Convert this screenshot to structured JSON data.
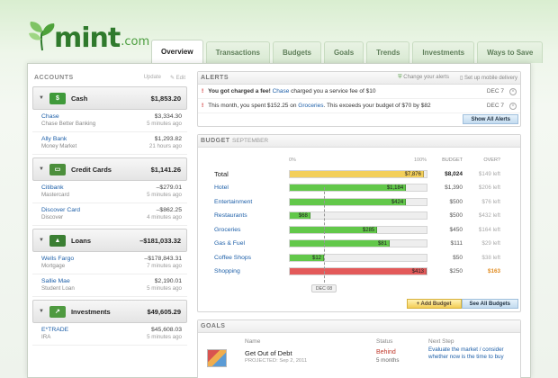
{
  "brand": {
    "name": "mint",
    "suffix": ".com"
  },
  "tabs": [
    {
      "label": "Overview",
      "active": true
    },
    {
      "label": "Transactions"
    },
    {
      "label": "Budgets"
    },
    {
      "label": "Goals"
    },
    {
      "label": "Trends"
    },
    {
      "label": "Investments"
    },
    {
      "label": "Ways to Save"
    }
  ],
  "sidebar": {
    "title": "ACCOUNTS",
    "update": "Update",
    "edit": "Edit",
    "groups": [
      {
        "name": "Cash",
        "total": "$1,853.20",
        "icon": "cash-icon",
        "accounts": [
          {
            "name": "Chase",
            "sub": "Chase Better Banking",
            "amount": "$3,334.30",
            "time": "5 minutes ago"
          },
          {
            "name": "Ally Bank",
            "sub": "Money Market",
            "amount": "$1,293.82",
            "time": "21 hours ago"
          }
        ]
      },
      {
        "name": "Credit Cards",
        "total": "$1,141.26",
        "icon": "credit-card-icon",
        "accounts": [
          {
            "name": "Citibank",
            "sub": "Mastercard",
            "amount": "–$279.01",
            "time": "5 minutes ago"
          },
          {
            "name": "Discover Card",
            "sub": "Discover",
            "amount": "–$862.25",
            "time": "4 minutes ago"
          }
        ]
      },
      {
        "name": "Loans",
        "total": "–$181,033.32",
        "icon": "graduation-cap-icon",
        "accounts": [
          {
            "name": "Wells Fargo",
            "sub": "Mortgage",
            "amount": "–$178,843.31",
            "time": "7 minutes ago"
          },
          {
            "name": "Sallie Mae",
            "sub": "Student Loan",
            "amount": "$2,190.01",
            "time": "5 minutes ago"
          }
        ]
      },
      {
        "name": "Investments",
        "total": "$49,605.29",
        "icon": "chart-icon",
        "accounts": [
          {
            "name": "E*TRADE",
            "sub": "IRA",
            "amount": "$45,608.03",
            "time": "5 minutes ago"
          }
        ]
      }
    ]
  },
  "alerts": {
    "title": "ALERTS",
    "change_link": "Change your alerts",
    "mobile_link": "Set up mobile delivery",
    "show_all": "Show All Alerts",
    "items": [
      {
        "pre": "You got charged a fee! ",
        "link": "Chase",
        "post": " charged you a service fee of $10",
        "date": "DEC 7",
        "bold": true
      },
      {
        "pre": "This month, you spent $152.25 on ",
        "link": "Groceries",
        "post": ". This exceeds your budget of $70 by $82",
        "date": "DEC 7",
        "bold": false
      }
    ]
  },
  "budget": {
    "title": "BUDGET",
    "month": "SEPTEMBER",
    "col_start": "0%",
    "col_end": "100%",
    "col_budget": "BUDGET",
    "col_over": "OVER?",
    "today_marker": "DEC 08",
    "today_fraction": 0.25,
    "add_button": "+ Add Budget",
    "see_all": "See All Budgets",
    "rows": [
      {
        "name": "Total",
        "spent": "$7,876",
        "fraction": 0.98,
        "budget": "$8,024",
        "over": "$149 left",
        "color": "#f3cf5a",
        "total": true
      },
      {
        "name": "Hotel",
        "spent": "$1,184",
        "fraction": 0.85,
        "budget": "$1,390",
        "over": "$206 left",
        "color": "#62c84a"
      },
      {
        "name": "Entertainment",
        "spent": "$424",
        "fraction": 0.85,
        "budget": "$500",
        "over": "$76 left",
        "color": "#62c84a"
      },
      {
        "name": "Restaurants",
        "spent": "$68",
        "fraction": 0.15,
        "budget": "$500",
        "over": "$432 left",
        "color": "#62c84a"
      },
      {
        "name": "Groceries",
        "spent": "$285",
        "fraction": 0.64,
        "budget": "$450",
        "over": "$164 left",
        "color": "#62c84a"
      },
      {
        "name": "Gas & Fuel",
        "spent": "$81",
        "fraction": 0.73,
        "budget": "$111",
        "over": "$29 left",
        "color": "#62c84a"
      },
      {
        "name": "Coffee Shops",
        "spent": "$12",
        "fraction": 0.25,
        "budget": "$50",
        "over": "$38 left",
        "color": "#62c84a"
      },
      {
        "name": "Shopping",
        "spent": "$413",
        "fraction": 1.0,
        "budget": "$250",
        "over": "$163",
        "color": "#e35a5a",
        "overbudget": true
      }
    ]
  },
  "goals": {
    "title": "GOALS",
    "col_name": "Name",
    "col_status": "Status",
    "col_next": "Next Step",
    "items": [
      {
        "name": "Get Out of Debt",
        "projected": "PROJECTED: Sep 2, 2011",
        "status": "Behind",
        "status_sub": "5 months",
        "next": "Evaluate the market / consider whether now is the time to buy"
      }
    ]
  }
}
